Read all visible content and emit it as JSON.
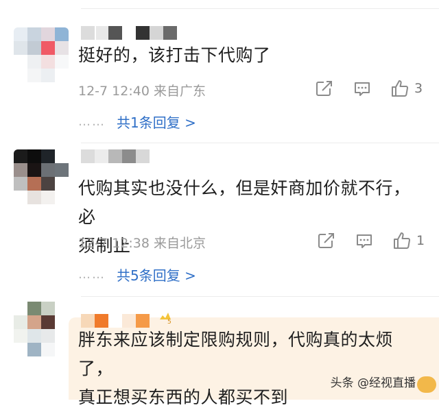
{
  "comments": [
    {
      "text": "挺好的，该打击下代购了",
      "date": "12-7 12:40",
      "location": "来自广东",
      "likes": "3",
      "replies": "共1条回复 >"
    },
    {
      "text_line1": "代购其实也没什么，但是奸商加价就不行，必",
      "text_line2": "须制止",
      "date": "12-7 12:38",
      "location": "来自北京",
      "likes": "1",
      "replies": "共5条回复 >"
    },
    {
      "text_line1": "胖东来应该制定限购规则，代购真的太烦了，",
      "text_line2": "真正想买东西的人都买不到"
    }
  ],
  "reply_dots": "……",
  "watermark": "头条 @经视直播",
  "colors": {
    "link": "#2f6fc7",
    "meta": "#9a9a9a",
    "bubble": "#fdf2e4"
  },
  "icons": [
    "share-icon",
    "comment-icon",
    "thumbs-up-icon"
  ]
}
